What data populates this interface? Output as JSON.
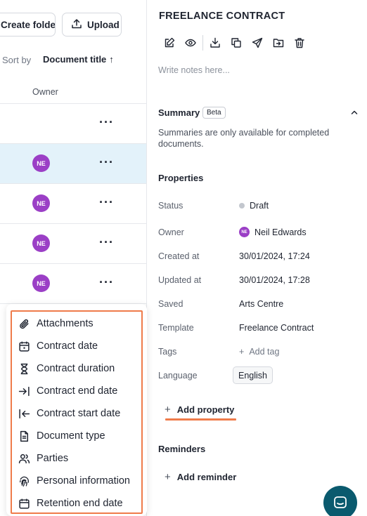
{
  "left": {
    "create_folder_label": "Create folder",
    "upload_label": "Upload",
    "sort_label": "Sort by",
    "sort_value": "Document title",
    "sort_arrow": "↑",
    "owner_column": "Owner",
    "rows": [
      {
        "avatar": "",
        "more": "···"
      },
      {
        "avatar": "NE",
        "more": "···"
      },
      {
        "avatar": "NE",
        "more": "···"
      },
      {
        "avatar": "NE",
        "more": "···"
      },
      {
        "avatar": "NE",
        "more": "···"
      }
    ],
    "property_menu": {
      "items": [
        {
          "label": "Attachments",
          "icon": "paperclip-icon"
        },
        {
          "label": "Contract date",
          "icon": "calendar-icon"
        },
        {
          "label": "Contract duration",
          "icon": "hourglass-icon"
        },
        {
          "label": "Contract end date",
          "icon": "arrow-to-end-icon"
        },
        {
          "label": "Contract start date",
          "icon": "arrow-to-start-icon"
        },
        {
          "label": "Document type",
          "icon": "document-icon"
        },
        {
          "label": "Parties",
          "icon": "people-icon"
        },
        {
          "label": "Personal information",
          "icon": "fingerprint-icon"
        },
        {
          "label": "Retention end date",
          "icon": "calendar-icon"
        }
      ]
    }
  },
  "right": {
    "title": "FREELANCE CONTRACT",
    "notes_placeholder": "Write notes here...",
    "summary": {
      "heading": "Summary",
      "badge": "Beta",
      "text": "Summaries are only available for completed documents."
    },
    "properties": {
      "heading": "Properties",
      "status_label": "Status",
      "status_value": "Draft",
      "owner_label": "Owner",
      "owner_initials": "NE",
      "owner_value": "Neil Edwards",
      "created_label": "Created at",
      "created_value": "30/01/2024, 17:24",
      "updated_label": "Updated at",
      "updated_value": "30/01/2024, 17:28",
      "saved_label": "Saved",
      "saved_value": "Arts Centre",
      "template_label": "Template",
      "template_value": "Freelance Contract",
      "tags_label": "Tags",
      "tags_value": "Add tag",
      "language_label": "Language",
      "language_value": "English",
      "add_property": "Add property"
    },
    "reminders": {
      "heading": "Reminders",
      "add_reminder": "Add reminder"
    }
  },
  "colors": {
    "accent": "#ef7b4a",
    "avatar": "#9b3fc6",
    "selected_row": "#e3f2fa",
    "chat_fab": "#0a5a6e"
  }
}
